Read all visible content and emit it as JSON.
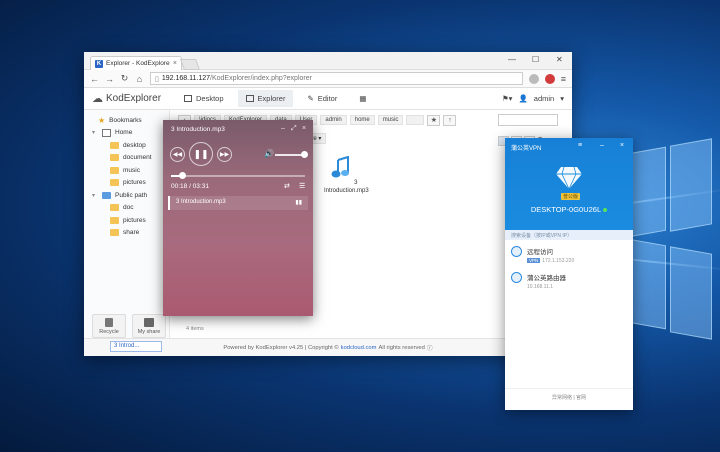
{
  "browser": {
    "tab_title": "Explorer - KodExplore",
    "url_host": "192.168.11.127",
    "url_path": "/KodExplorer/index.php?explorer",
    "window_controls": [
      "—",
      "☐",
      "✕"
    ]
  },
  "app": {
    "logo_text": "KodExplorer",
    "nav_tabs": [
      {
        "label": "Desktop",
        "icon": "monitor-icon"
      },
      {
        "label": "Explorer",
        "icon": "explorer-icon"
      },
      {
        "label": "Editor",
        "icon": "edit-icon"
      }
    ],
    "user_name": "admin"
  },
  "sidebar": {
    "bookmarks_label": "Bookmarks",
    "home_label": "Home",
    "home_children": [
      "desktop",
      "document",
      "music",
      "pictures"
    ],
    "public_label": "Public path",
    "public_children": [
      "doc",
      "pictures",
      "share"
    ],
    "dock": [
      {
        "label": "Recycle",
        "icon": "recycle-icon"
      },
      {
        "label": "My share",
        "icon": "share-icon"
      }
    ]
  },
  "pathbar": {
    "crumbs": [
      "\\idiocs",
      "KodExplorer",
      "data",
      "User",
      "admin",
      "home",
      "music"
    ]
  },
  "toolbar": {
    "more_label": "More ▾"
  },
  "files": [
    {
      "name": "3 Introduction.mp3"
    }
  ],
  "status": {
    "count_text": "4 items"
  },
  "footer": {
    "prefix": "Powered by KodExplorer v4.25 | Copyright ©",
    "link": "kodcloud.com",
    "suffix": "All rights reserved"
  },
  "taskchip": "3 Introd...",
  "player": {
    "title": "3 Introduction.mp3",
    "time": "00:18 / 03:31",
    "progress": 0.085,
    "volume": 0.9,
    "playlist": [
      "3 Introduction.mp3"
    ]
  },
  "vpn": {
    "title": "蒲公英VPN",
    "badge": "普公版",
    "hostname": "DESKTOP-0G0U26L",
    "search_placeholder": "搜索设备（按IP或VPN IP）",
    "items": [
      {
        "name": "远程访问",
        "tag": "VPN",
        "sub": "172.1.153.220"
      },
      {
        "name": "蒲公英路由器",
        "tag": "",
        "sub": "10.168.11.1"
      }
    ],
    "footer": "异常网络 | 官网"
  }
}
